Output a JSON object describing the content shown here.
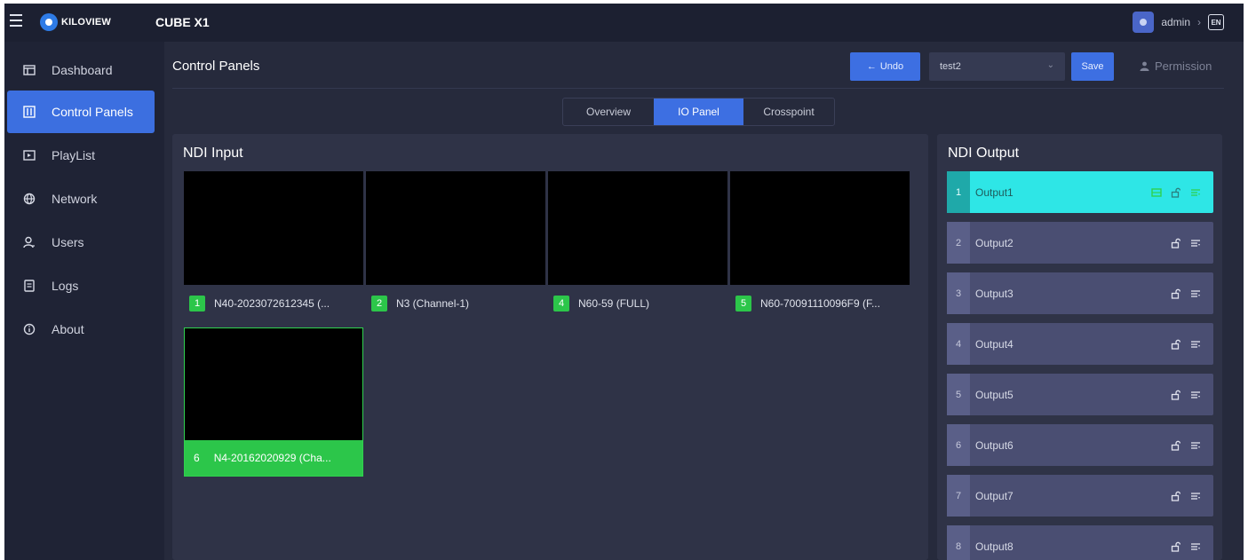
{
  "app": {
    "logo_text": "KILOVIEW",
    "product": "CUBE X1",
    "user": "admin",
    "lang": "EN"
  },
  "sidebar": {
    "items": [
      {
        "label": "Dashboard",
        "icon": "dashboard-icon"
      },
      {
        "label": "Control Panels",
        "icon": "control-panels-icon",
        "active": true
      },
      {
        "label": "PlayList",
        "icon": "playlist-icon"
      },
      {
        "label": "Network",
        "icon": "globe-icon"
      },
      {
        "label": "Users",
        "icon": "users-icon"
      },
      {
        "label": "Logs",
        "icon": "logs-icon"
      },
      {
        "label": "About",
        "icon": "info-icon"
      }
    ]
  },
  "header": {
    "title": "Control Panels",
    "undo_label": "Undo",
    "preset_value": "test2",
    "save_label": "Save",
    "permission_label": "Permission"
  },
  "tabs": [
    {
      "label": "Overview"
    },
    {
      "label": "IO Panel",
      "active": true
    },
    {
      "label": "Crosspoint"
    }
  ],
  "inputs": {
    "title": "NDI Input",
    "items": [
      {
        "number": "1",
        "label": "N40-2023072612345 (..."
      },
      {
        "number": "2",
        "label": "N3 (Channel-1)"
      },
      {
        "number": "4",
        "label": "N60-59 (FULL)"
      },
      {
        "number": "5",
        "label": "N60-70091110096F9 (F..."
      },
      {
        "number": "6",
        "label": "N4-20162020929 (Cha...",
        "selected": true
      }
    ]
  },
  "outputs": {
    "title": "NDI Output",
    "items": [
      {
        "index": "1",
        "label": "Output1",
        "active": true
      },
      {
        "index": "2",
        "label": "Output2"
      },
      {
        "index": "3",
        "label": "Output3"
      },
      {
        "index": "4",
        "label": "Output4"
      },
      {
        "index": "5",
        "label": "Output5"
      },
      {
        "index": "6",
        "label": "Output6"
      },
      {
        "index": "7",
        "label": "Output7"
      },
      {
        "index": "8",
        "label": "Output8"
      }
    ]
  },
  "colors": {
    "accent": "#3d6fe2",
    "success": "#2cc64a",
    "output_active": "#2ee6e6"
  }
}
